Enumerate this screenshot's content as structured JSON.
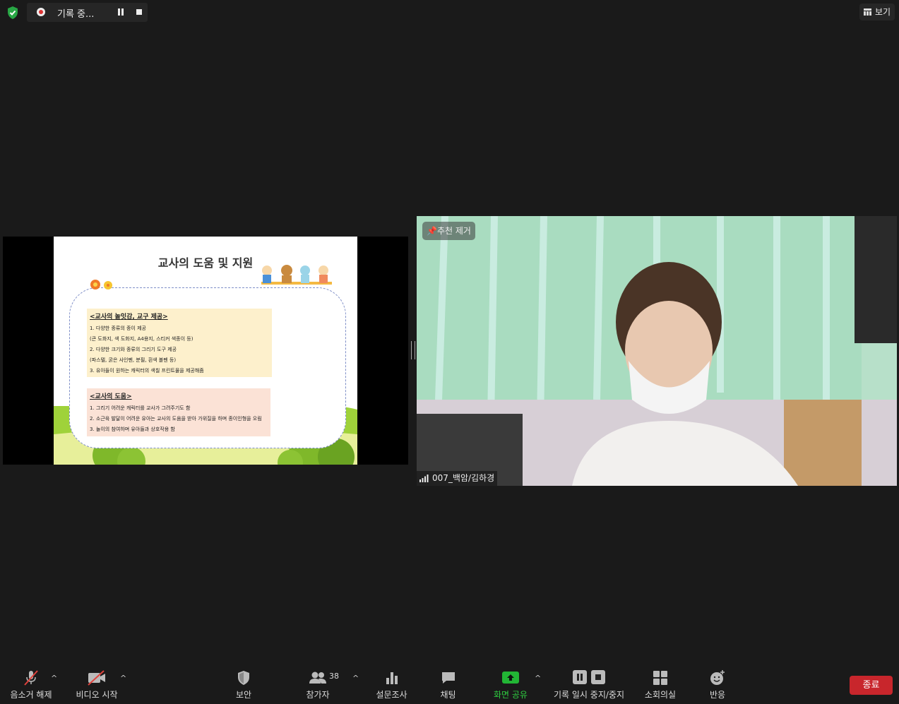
{
  "top": {
    "recording_label": "기록 중...",
    "view_label": "보기"
  },
  "slide": {
    "title": "교사의 도움 및 지원",
    "box1": {
      "heading": "<교사의 놀잇감, 교구 제공>",
      "lines": [
        "1. 다양한 종류의 종이 제공",
        "  (큰 도화지, 색 도화지, A4용지, 스티커 색종이 등)",
        "2. 다양한 크기와 종류의 그리기 도구 제공",
        "  (파스텔, 굵은 사인펜, 분필, 흰색 볼펜 등)",
        "3. 유아들이 원하는 캐릭터의 색칠 프린트물을 제공해줌"
      ]
    },
    "box2": {
      "heading": "<교사의 도움>",
      "lines": [
        "1. 그리기 어려운 캐릭터를 교사가 그려주기도 함",
        "2. 소근육 발달이 어려운 유아는 교사의 도움을 받아 가위질을 하며 종이인형을 오림",
        "3. 놀이의 참여하며 유아들과 상호작용 함"
      ]
    }
  },
  "video": {
    "pin_label": "추천 제거",
    "participant_name": "007_백암/김하경"
  },
  "toolbar": {
    "mute_label": "음소거 해제",
    "video_label": "비디오 시작",
    "security_label": "보안",
    "participants_label": "참가자",
    "participants_count": "38",
    "polls_label": "설문조사",
    "chat_label": "채팅",
    "share_label": "화면 공유",
    "record_label": "기록 일시 중지/중지",
    "breakout_label": "소회의실",
    "reactions_label": "반응",
    "end_label": "종료",
    "share_color": "#2ecc40"
  },
  "icons": [
    "shield-icon",
    "record-dot-icon",
    "pause-icon",
    "stop-icon",
    "grid-view-icon",
    "unpin-icon",
    "signal-icon",
    "mic-muted-icon",
    "video-off-icon",
    "security-shield-icon",
    "participants-icon",
    "polls-icon",
    "chat-icon",
    "share-screen-icon",
    "record-pause-icon",
    "record-stop-icon",
    "breakout-rooms-icon",
    "reactions-icon"
  ]
}
